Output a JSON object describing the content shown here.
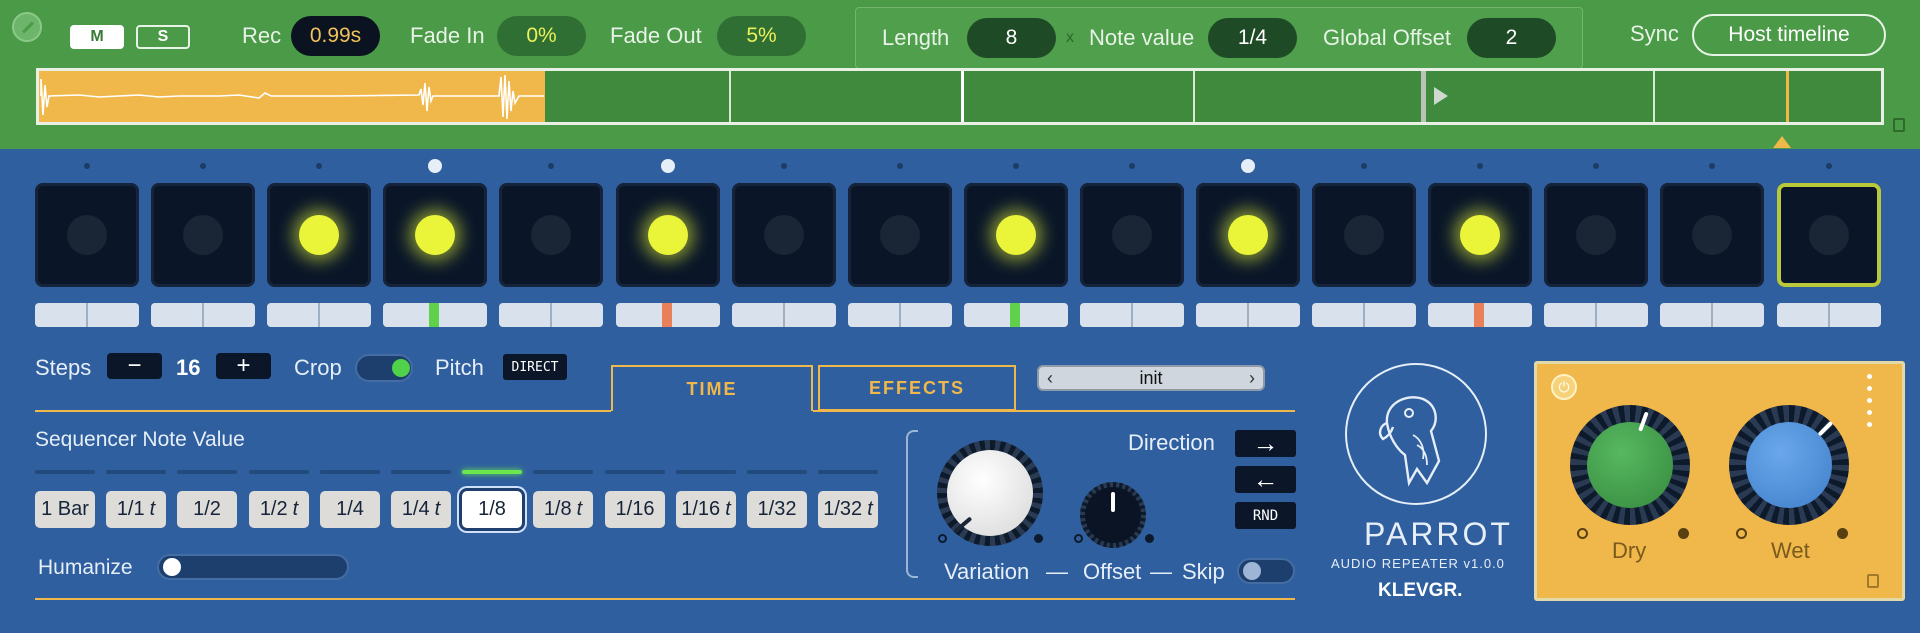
{
  "header": {
    "m_label": "M",
    "s_label": "S",
    "rec_label": "Rec",
    "rec_value": "0.99s",
    "fade_in_label": "Fade In",
    "fade_in_value": "0%",
    "fade_out_label": "Fade Out",
    "fade_out_value": "5%",
    "length_label": "Length",
    "length_value": "8",
    "times_sign": "x",
    "note_value_label": "Note value",
    "note_value": "1/4",
    "global_offset_label": "Global Offset",
    "global_offset_value": "2",
    "sync_label": "Sync",
    "sync_value": "Host timeline"
  },
  "sequencer": {
    "pads": [
      {
        "on": false,
        "selected": false,
        "indicator": "small",
        "mark": ""
      },
      {
        "on": false,
        "selected": false,
        "indicator": "small",
        "mark": ""
      },
      {
        "on": true,
        "selected": false,
        "indicator": "small",
        "mark": ""
      },
      {
        "on": true,
        "selected": false,
        "indicator": "big",
        "mark": "#5fd14a"
      },
      {
        "on": false,
        "selected": false,
        "indicator": "small",
        "mark": ""
      },
      {
        "on": true,
        "selected": false,
        "indicator": "big",
        "mark": "#e8805a"
      },
      {
        "on": false,
        "selected": false,
        "indicator": "small",
        "mark": ""
      },
      {
        "on": false,
        "selected": false,
        "indicator": "small",
        "mark": ""
      },
      {
        "on": true,
        "selected": false,
        "indicator": "small",
        "mark": "#5fd14a"
      },
      {
        "on": false,
        "selected": false,
        "indicator": "small",
        "mark": ""
      },
      {
        "on": true,
        "selected": false,
        "indicator": "big",
        "mark": ""
      },
      {
        "on": false,
        "selected": false,
        "indicator": "small",
        "mark": ""
      },
      {
        "on": true,
        "selected": false,
        "indicator": "small",
        "mark": "#e8805a"
      },
      {
        "on": false,
        "selected": false,
        "indicator": "small",
        "mark": ""
      },
      {
        "on": false,
        "selected": false,
        "indicator": "small",
        "mark": ""
      },
      {
        "on": false,
        "selected": true,
        "indicator": "small",
        "mark": ""
      }
    ]
  },
  "controls": {
    "steps_label": "Steps",
    "minus_label": "−",
    "steps_value": "16",
    "plus_label": "+",
    "crop_label": "Crop",
    "crop_on": true,
    "pitch_label": "Pitch",
    "pitch_mode": "DIRECT",
    "tab_time": "TIME",
    "tab_effects": "EFFECTS",
    "preset_name": "init",
    "preset_prev": "‹",
    "preset_next": "›",
    "seq_note_value_label": "Sequencer Note Value",
    "note_values": [
      {
        "label": "1 Bar",
        "t": ""
      },
      {
        "label": "1/1",
        "t": "t"
      },
      {
        "label": "1/2",
        "t": ""
      },
      {
        "label": "1/2",
        "t": "t"
      },
      {
        "label": "1/4",
        "t": ""
      },
      {
        "label": "1/4",
        "t": "t"
      },
      {
        "label": "1/8",
        "t": ""
      },
      {
        "label": "1/8",
        "t": "t"
      },
      {
        "label": "1/16",
        "t": ""
      },
      {
        "label": "1/16",
        "t": "t"
      },
      {
        "label": "1/32",
        "t": ""
      },
      {
        "label": "1/32",
        "t": "t"
      }
    ],
    "active_note_value_index": 6,
    "humanize_label": "Humanize",
    "humanize_value": 0
  },
  "modulation": {
    "direction_label": "Direction",
    "dir_forward": "→",
    "dir_backward": "←",
    "dir_random": "RND",
    "variation_label": "Variation",
    "dash": "—",
    "offset_label": "Offset",
    "skip_label": "Skip",
    "skip_on": false
  },
  "brand": {
    "product": "PARROT",
    "subtitle": "AUDIO REPEATER v1.0.0",
    "company": "KLEVGR."
  },
  "mix": {
    "power_icon": "⏻",
    "dry_label": "Dry",
    "wet_label": "Wet"
  },
  "colors": {
    "header_green": "#4a9a47",
    "panel_blue": "#2f5f9e",
    "accent_yellow": "#f0b84a",
    "led_on": "#eaf53a",
    "dry_knob": "#3f9a4a",
    "wet_knob": "#4d8fd8"
  }
}
